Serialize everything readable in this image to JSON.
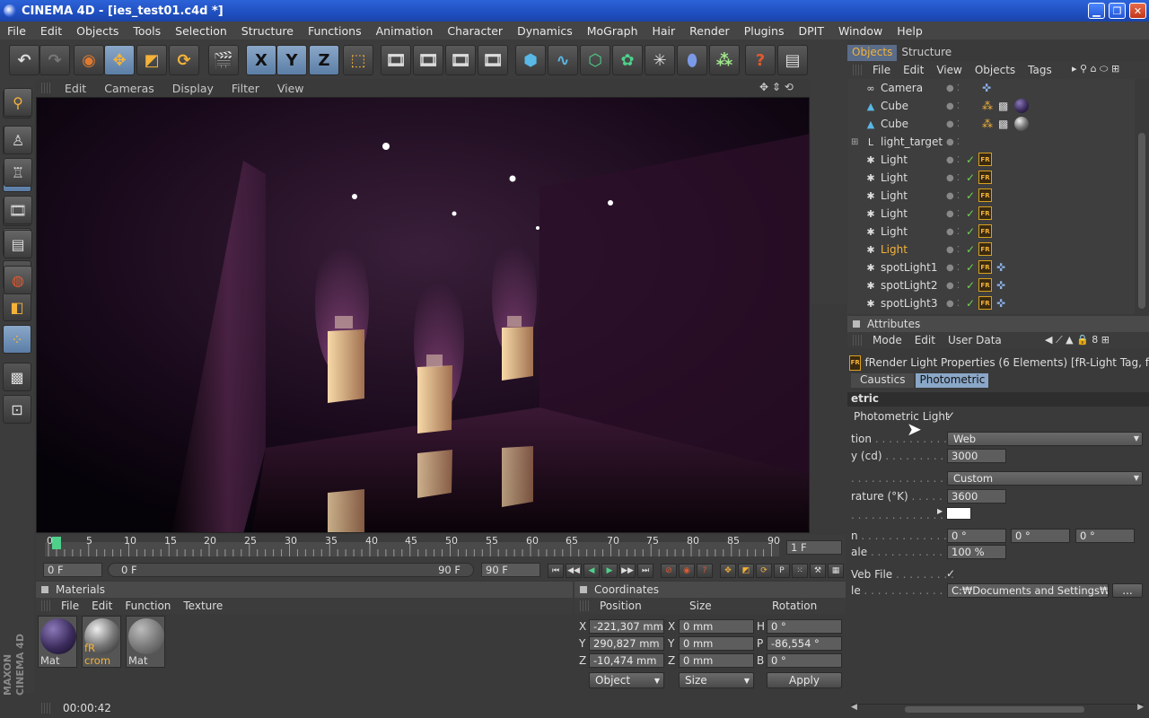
{
  "window": {
    "title": "CINEMA 4D - [ies_test01.c4d *]"
  },
  "menubar": [
    "File",
    "Edit",
    "Objects",
    "Tools",
    "Selection",
    "Structure",
    "Functions",
    "Animation",
    "Character",
    "Dynamics",
    "MoGraph",
    "Hair",
    "Render",
    "Plugins",
    "DPIT",
    "Window",
    "Help"
  ],
  "toolbar": {
    "undo": "undo-icon",
    "redo": "redo-icon",
    "select": "pointer-icon",
    "move": "move-icon",
    "scale": "scale-icon",
    "rotate": "rotate-icon",
    "x": "X",
    "y": "Y",
    "z": "Z"
  },
  "viewport": {
    "menu": [
      "Edit",
      "Cameras",
      "Display",
      "Filter",
      "View"
    ]
  },
  "timeline": {
    "ticks": [
      "0",
      "5",
      "10",
      "15",
      "20",
      "25",
      "30",
      "35",
      "40",
      "45",
      "50",
      "55",
      "60",
      "65",
      "70",
      "75",
      "80",
      "85",
      "90"
    ],
    "current_frame": "1 F",
    "start": "0 F",
    "range_start": "0 F",
    "range_end": "90 F",
    "end": "90 F"
  },
  "materials": {
    "title": "Materials",
    "menu": [
      "File",
      "Edit",
      "Function",
      "Texture"
    ],
    "items": [
      {
        "label": "Mat",
        "color": "#3b2c5c"
      },
      {
        "label": "fR crom",
        "color": "#8a8a8a"
      },
      {
        "label": "Mat",
        "color": "#7a7a7a"
      }
    ]
  },
  "coordinates": {
    "title": "Coordinates",
    "headers": [
      "Position",
      "Size",
      "Rotation"
    ],
    "rows": [
      {
        "axis": "X",
        "pos": "-221,307 mm",
        "size_axis": "X",
        "size": "0 mm",
        "rot_axis": "H",
        "rot": "0 °"
      },
      {
        "axis": "Y",
        "pos": "290,827 mm",
        "size_axis": "Y",
        "size": "0 mm",
        "rot_axis": "P",
        "rot": "-86,554 °"
      },
      {
        "axis": "Z",
        "pos": "-10,474 mm",
        "size_axis": "Z",
        "size": "0 mm",
        "rot_axis": "B",
        "rot": "0 °"
      }
    ],
    "mode": "Object",
    "size_mode": "Size",
    "apply": "Apply"
  },
  "status": {
    "time": "00:00:42"
  },
  "objects": {
    "tabs": [
      "Objects",
      "Structure"
    ],
    "menu": [
      "File",
      "Edit",
      "View",
      "Objects",
      "Tags"
    ],
    "items": [
      {
        "name": "Camera",
        "icon": "camera-icon"
      },
      {
        "name": "Cube",
        "icon": "cube-icon"
      },
      {
        "name": "Cube",
        "icon": "cube-icon"
      },
      {
        "name": "light_target",
        "icon": "null-icon"
      },
      {
        "name": "Light",
        "icon": "light-icon"
      },
      {
        "name": "Light",
        "icon": "light-icon"
      },
      {
        "name": "Light",
        "icon": "light-icon"
      },
      {
        "name": "Light",
        "icon": "light-icon"
      },
      {
        "name": "Light",
        "icon": "light-icon"
      },
      {
        "name": "Light",
        "icon": "light-icon",
        "selected": true
      },
      {
        "name": "spotLight1",
        "icon": "light-icon"
      },
      {
        "name": "spotLight2",
        "icon": "light-icon"
      },
      {
        "name": "spotLight3",
        "icon": "light-icon"
      }
    ]
  },
  "attributes": {
    "title": "Attributes",
    "menu": [
      "Mode",
      "Edit",
      "User Data"
    ],
    "header": "fRender Light Properties (6 Elements) [fR-Light Tag, f",
    "tabs": [
      "Caustics",
      "Photometric"
    ],
    "section": "etric",
    "photometric_light": "Photometric Light",
    "distribution_label": "tion",
    "distribution_value": "Web",
    "intensity_label": "y (cd)",
    "intensity_value": "3000",
    "color_mode_value": "Custom",
    "temperature_label": "rature (°K)",
    "temperature_value": "3600",
    "rot_label": "n",
    "rot_values": [
      "0 °",
      "0 °",
      "0 °"
    ],
    "scale_label": "ale",
    "scale_value": "100 %",
    "web_file_label": "Veb File",
    "file_label": "le",
    "file_path": "C:₩Documents and Settings₩",
    "browse": "..."
  },
  "brand": "MAXON CINEMA 4D"
}
